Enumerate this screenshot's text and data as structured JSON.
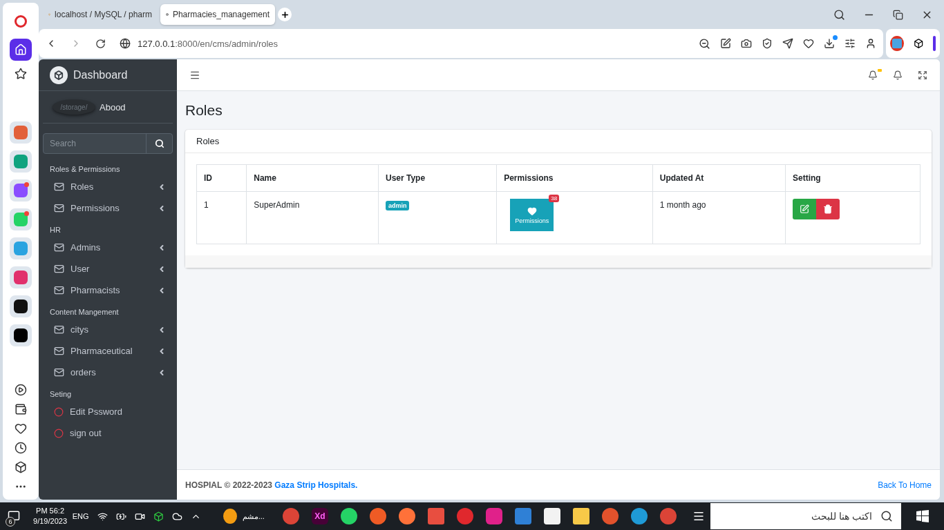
{
  "browser": {
    "tabs": [
      {
        "title": "localhost / MySQL / pharm",
        "selected": false
      },
      {
        "title": "Pharmacies_management",
        "selected": true
      }
    ],
    "url": {
      "host": "127.0.0.1",
      "rest": ":8000/en/cms/admin/roles"
    }
  },
  "side_apps": [
    {
      "color": "#e2603a",
      "notification": false
    },
    {
      "color": "#10a37f",
      "notification": false
    },
    {
      "color": "#8a4dff",
      "notification": true
    },
    {
      "color": "#25d366",
      "notification": true
    },
    {
      "color": "#2aa3e0",
      "notification": false
    },
    {
      "color": "#e1306c",
      "notification": false
    },
    {
      "color": "#111111",
      "notification": false
    },
    {
      "color": "#000000",
      "notification": false
    }
  ],
  "sidebar": {
    "brand": "Dashboard",
    "avatar_alt": "/storage/",
    "user": "Abood",
    "search": {
      "placeholder": "Search"
    },
    "sections": [
      {
        "title": "Roles & Permissions",
        "items": [
          {
            "label": "Roles",
            "kind": "menu"
          },
          {
            "label": "Permissions",
            "kind": "menu"
          }
        ]
      },
      {
        "title": "HR",
        "items": [
          {
            "label": "Admins",
            "kind": "menu"
          },
          {
            "label": "User",
            "kind": "menu"
          },
          {
            "label": "Pharmacists",
            "kind": "menu"
          }
        ]
      },
      {
        "title": "Content Mangement",
        "items": [
          {
            "label": "citys",
            "kind": "menu"
          },
          {
            "label": "Pharmaceutical",
            "kind": "menu"
          },
          {
            "label": "orders",
            "kind": "menu"
          }
        ]
      },
      {
        "title": "Seting",
        "items": [
          {
            "label": "Edit Pssword",
            "kind": "action"
          },
          {
            "label": "sign out",
            "kind": "action"
          }
        ]
      }
    ]
  },
  "page": {
    "title": "Roles",
    "card_title": "Roles",
    "table": {
      "columns": [
        "ID",
        "Name",
        "User Type",
        "Permissions",
        "Updated At",
        "Setting"
      ],
      "rows": [
        {
          "id": "1",
          "name": "SuperAdmin",
          "user_type": "admin",
          "permissions": {
            "label": "Permissions",
            "count": "38"
          },
          "updated": "1 month ago"
        }
      ]
    }
  },
  "footer": {
    "text": "HOSPIAL © 2022-2023 **Gaza Strip Hospitals.**",
    "link": "Back To Home"
  },
  "taskbar": {
    "notifications": "6",
    "time": "PM 56:2",
    "date": "9/19/2023",
    "language": "ENG",
    "weather": "مشم...",
    "apps": [
      {
        "kind": "chrome"
      },
      {
        "kind": "xd",
        "label": "Xd"
      },
      {
        "kind": "whatsapp"
      },
      {
        "kind": "postman"
      },
      {
        "kind": "firefox"
      },
      {
        "kind": "git"
      },
      {
        "kind": "opera"
      },
      {
        "kind": "wamp"
      },
      {
        "kind": "vscode"
      },
      {
        "kind": "store"
      },
      {
        "kind": "folder"
      },
      {
        "kind": "anydesk"
      },
      {
        "kind": "edge"
      },
      {
        "kind": "chrome"
      }
    ],
    "search_placeholder": "اكتب هنا للبحث"
  }
}
